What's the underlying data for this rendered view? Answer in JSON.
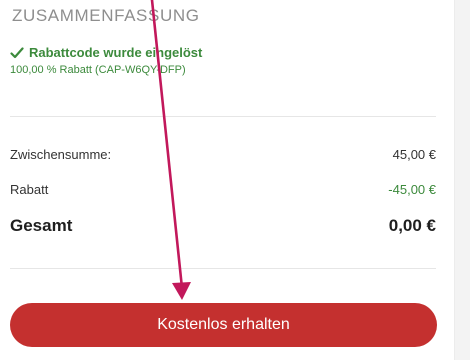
{
  "summary": {
    "title": "ZUSAMMENFASSUNG",
    "coupon_message": "Rabattcode wurde eingelöst",
    "coupon_detail": "100,00 % Rabatt (CAP-W6QY-DFP)",
    "subtotal_label": "Zwischensumme:",
    "subtotal_value": "45,00 €",
    "discount_label": "Rabatt",
    "discount_value": "-45,00 €",
    "total_label": "Gesamt",
    "total_value": "0,00 €",
    "cta_label": "Kostenlos erhalten"
  },
  "colors": {
    "accent_red": "#c4302f",
    "success_green": "#3c8a3c",
    "annotation_arrow": "#c2185b"
  },
  "icons": {
    "coupon": "check-icon"
  }
}
